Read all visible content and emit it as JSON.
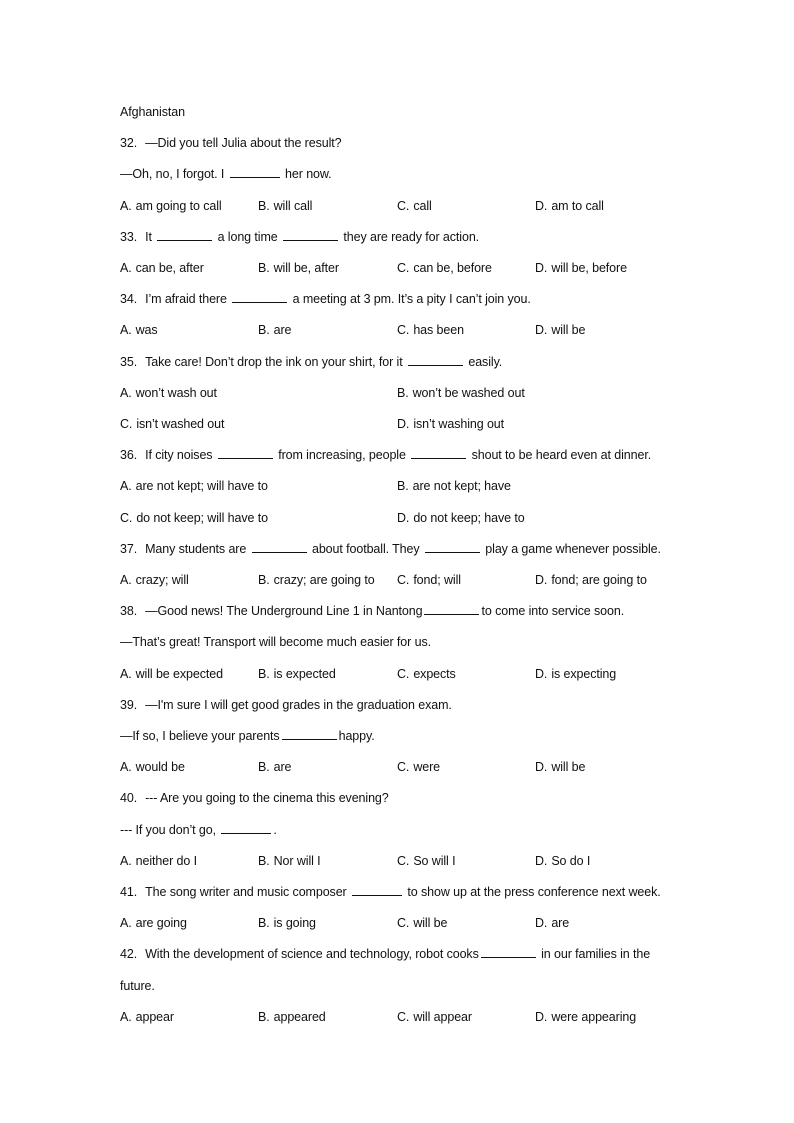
{
  "heading_fragment": "Afghanistan",
  "questions": [
    {
      "number": "32.",
      "stem": [
        [
          "—Did you tell Julia about the result?"
        ],
        [
          "—Oh, no, I forgot. I ",
          "_",
          " her now."
        ]
      ],
      "layout": 4,
      "options": [
        [
          "A.",
          "am going to call"
        ],
        [
          "B.",
          "will call"
        ],
        [
          "C.",
          "call"
        ],
        [
          "D.",
          "am to call"
        ]
      ]
    },
    {
      "number": "33.",
      "stem": [
        [
          "It ",
          "_",
          " a long time ",
          "_",
          " they are ready for action."
        ]
      ],
      "layout": 4,
      "options": [
        [
          "A.",
          "can be, after"
        ],
        [
          "B.",
          "will be, after"
        ],
        [
          "C.",
          "can be, before"
        ],
        [
          "D.",
          "will be, before"
        ]
      ]
    },
    {
      "number": "34.",
      "stem": [
        [
          "I’m afraid there ",
          "_",
          " a meeting at 3 pm. It’s a pity I can’t join you."
        ]
      ],
      "layout": 4,
      "options": [
        [
          "A.",
          "was"
        ],
        [
          "B.",
          "are"
        ],
        [
          "C.",
          "has been"
        ],
        [
          "D.",
          "will be"
        ]
      ]
    },
    {
      "number": "35.",
      "stem": [
        [
          "Take care! Don’t drop the ink on your shirt, for it ",
          "_",
          " easily."
        ]
      ],
      "layout": 2,
      "options": [
        [
          "A.",
          "won’t wash out"
        ],
        [
          "B.",
          "won’t be washed out"
        ],
        [
          "C.",
          "isn’t washed out"
        ],
        [
          "D.",
          "isn’t washing out"
        ]
      ]
    },
    {
      "number": "36.",
      "stem": [
        [
          "If city noises ",
          "_",
          " from increasing, people ",
          "_",
          " shout to be heard even at dinner."
        ]
      ],
      "layout": 2,
      "options": [
        [
          "A.",
          "are not kept; will have to"
        ],
        [
          "B.",
          "are not kept; have"
        ],
        [
          "C.",
          "do not keep; will have to"
        ],
        [
          "D.",
          "do not keep; have to"
        ]
      ]
    },
    {
      "number": "37.",
      "stem": [
        [
          "Many students are ",
          "_",
          " about football. They ",
          "_",
          " play a game whenever possible."
        ]
      ],
      "layout": 4,
      "options": [
        [
          "A.",
          "crazy; will"
        ],
        [
          "B.",
          "crazy; are going to"
        ],
        [
          "C.",
          "fond; will"
        ],
        [
          "D.",
          "fond; are going to"
        ]
      ]
    },
    {
      "number": "38.",
      "stem": [
        [
          "—Good news! The Underground Line 1 in Nantong",
          "_",
          "to come into service soon."
        ],
        [
          "—That’s great! Transport will become much easier for us."
        ]
      ],
      "layout": 4,
      "options": [
        [
          "A.",
          "will be expected"
        ],
        [
          "B.",
          "is expected"
        ],
        [
          "C.",
          "expects"
        ],
        [
          "D.",
          "is expecting"
        ]
      ]
    },
    {
      "number": "39.",
      "stem": [
        [
          "—I'm sure I will get good grades in the graduation exam."
        ],
        [
          "—If so, I believe your parents",
          "_",
          "happy."
        ]
      ],
      "layout": 4,
      "options": [
        [
          "A.",
          "would be"
        ],
        [
          "B.",
          "are"
        ],
        [
          "C.",
          "were"
        ],
        [
          "D.",
          "will be"
        ]
      ]
    },
    {
      "number": "40.",
      "stem": [
        [
          "--- Are you going to the cinema this evening?"
        ],
        [
          "--- If you don’t go, ",
          "_",
          "."
        ]
      ],
      "layout": 4,
      "options": [
        [
          "A.",
          "neither do I"
        ],
        [
          "B.",
          "Nor will I"
        ],
        [
          "C.",
          "So will I"
        ],
        [
          "D.",
          "So do I"
        ]
      ]
    },
    {
      "number": "41.",
      "stem": [
        [
          "The song writer and music composer ",
          "_",
          " to show up at the press conference next week."
        ]
      ],
      "layout": 4,
      "options": [
        [
          "A.",
          "are going"
        ],
        [
          "B.",
          "is going"
        ],
        [
          "C.",
          "will be"
        ],
        [
          "D.",
          "are"
        ]
      ]
    },
    {
      "number": "42.",
      "stem": [
        [
          "With the development of science and technology, robot cooks",
          "_",
          " in our families in the"
        ],
        [
          "future."
        ]
      ],
      "layout": 4,
      "options": [
        [
          "A.",
          "appear"
        ],
        [
          "B.",
          "appeared"
        ],
        [
          "C.",
          "will appear"
        ],
        [
          "D.",
          "were appearing"
        ]
      ]
    }
  ]
}
